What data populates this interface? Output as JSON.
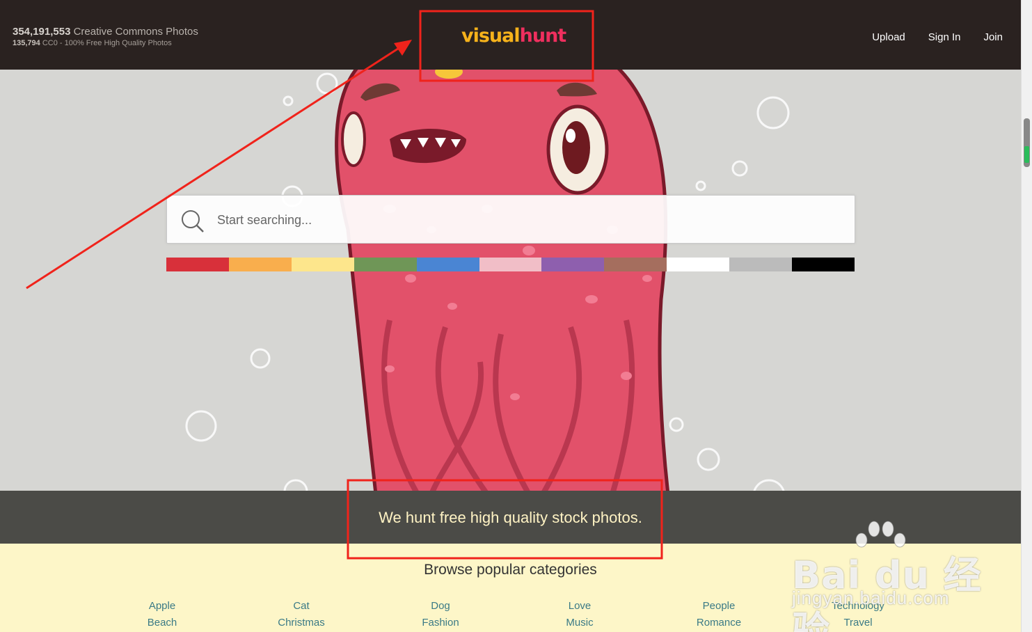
{
  "header": {
    "photo_count": "354,191,553",
    "photo_count_label": "Creative Commons Photos",
    "cc0_count": "135,794",
    "cc0_label": "CC0 - 100% Free High Quality Photos",
    "logo_part1": "visual",
    "logo_part2": "hunt",
    "nav": {
      "upload": "Upload",
      "sign_in": "Sign In",
      "join": "Join"
    }
  },
  "search": {
    "placeholder": "Start searching..."
  },
  "color_filters": [
    "#d8303a",
    "#f9ae4d",
    "#fde68c",
    "#6f9657",
    "#4a85d3",
    "#f1bec7",
    "#8e5fae",
    "#a56e5e",
    "#ffffff",
    "#bbbbbb",
    "#000000"
  ],
  "tagline": "We hunt free high quality stock photos.",
  "categories": {
    "heading": "Browse popular categories",
    "columns": [
      [
        "Apple",
        "Beach"
      ],
      [
        "Cat",
        "Christmas"
      ],
      [
        "Dog",
        "Fashion"
      ],
      [
        "Love",
        "Music"
      ],
      [
        "People",
        "Romance"
      ],
      [
        "Technology",
        "Travel"
      ]
    ]
  },
  "watermark": {
    "brand": "Bai du 经验",
    "url": "jingyan.baidu.com"
  },
  "colors": {
    "header_bg": "#2a2220",
    "logo_yellow": "#f6b21b",
    "logo_pink": "#ef2f5e",
    "annotation_red": "#f0231b"
  }
}
